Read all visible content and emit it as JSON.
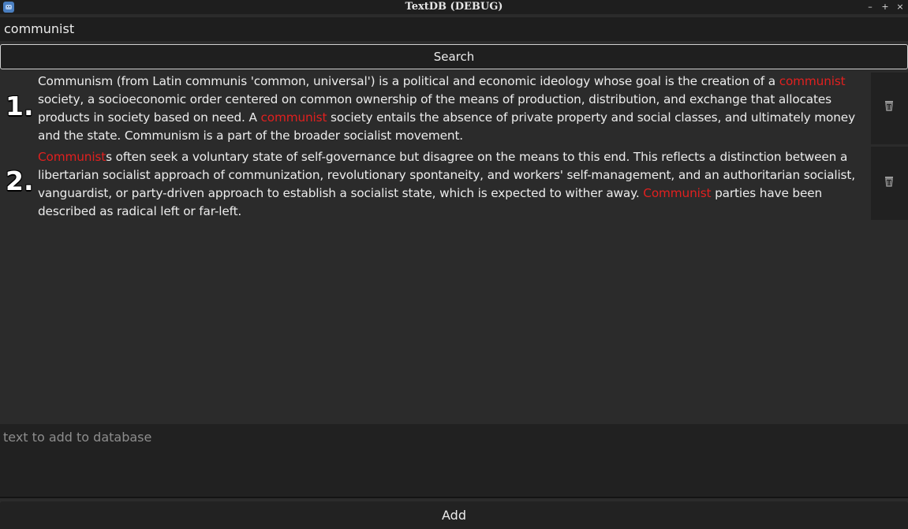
{
  "window": {
    "title": "TextDB (DEBUG)",
    "minimize_glyph": "–",
    "maximize_glyph": "+",
    "close_glyph": "×"
  },
  "search": {
    "value": "communist",
    "button_label": "Search"
  },
  "results": [
    {
      "number": "1.",
      "segments": [
        {
          "text": "Communism (from Latin communis 'common, universal') is a political and economic ideology whose goal is the creation of a ",
          "highlight": false
        },
        {
          "text": "communist",
          "highlight": true
        },
        {
          "text": " society, a socioeconomic order centered on common ownership of the means of production, distribution, and exchange that allocates products in society based on need. A ",
          "highlight": false
        },
        {
          "text": "communist",
          "highlight": true
        },
        {
          "text": " society entails the absence of private property and social classes, and ultimately money and the state. Communism is a part of the broader socialist movement.",
          "highlight": false
        }
      ]
    },
    {
      "number": "2.",
      "segments": [
        {
          "text": "Communist",
          "highlight": true
        },
        {
          "text": "s often seek a voluntary state of self-governance but disagree on the means to this end. This reflects a distinction between a libertarian socialist approach of communization, revolutionary spontaneity, and workers' self-management, and an authoritarian socialist, vanguardist, or party-driven approach to establish a socialist state, which is expected to wither away. ",
          "highlight": false
        },
        {
          "text": "Communist",
          "highlight": true
        },
        {
          "text": " parties have been described as radical left or far-left.",
          "highlight": false
        }
      ]
    }
  ],
  "add": {
    "placeholder": "text to add to database",
    "button_label": "Add"
  },
  "colors": {
    "highlight": "#e0201f",
    "background": "#2b2b2b",
    "field": "#1e1e1e"
  },
  "icons": {
    "delete": "trash-icon",
    "app": "app-icon"
  }
}
